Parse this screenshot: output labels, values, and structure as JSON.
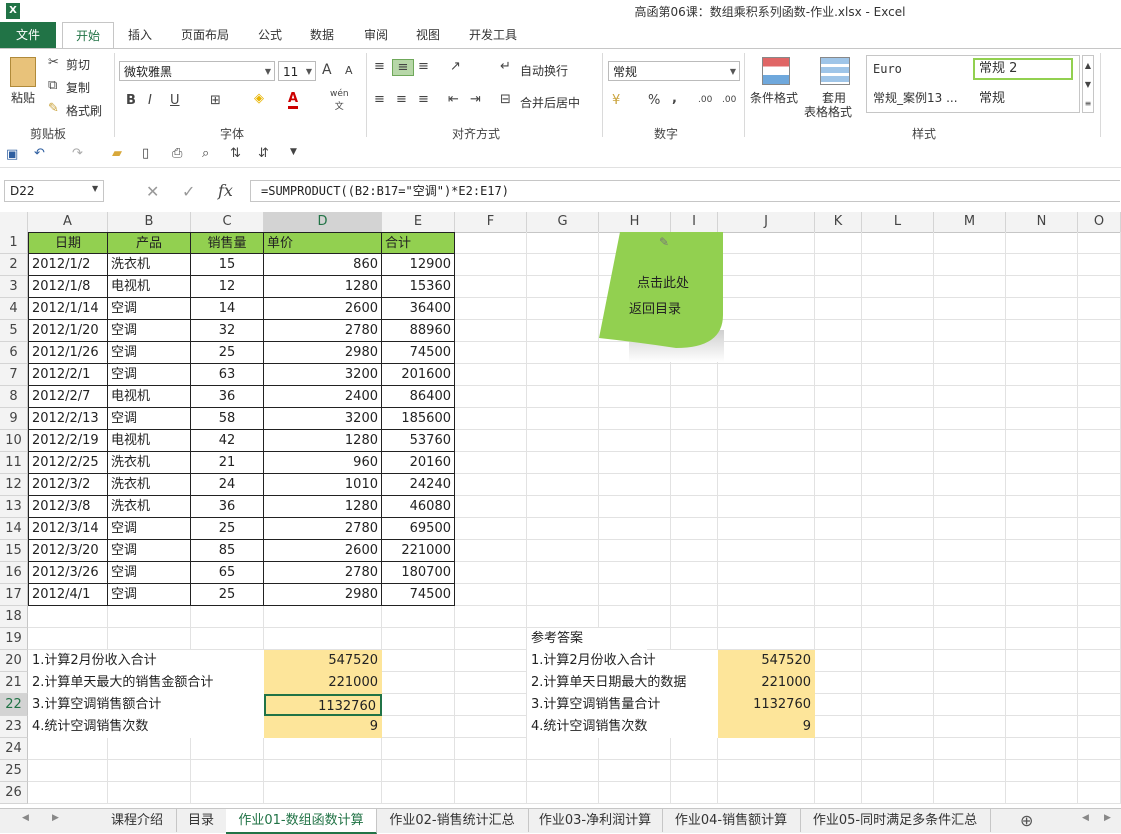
{
  "window": {
    "title": "高函第06课：数组乘积系列函数-作业.xlsx - Excel",
    "logo": "X"
  },
  "ribbon_tabs": [
    "文件",
    "开始",
    "插入",
    "页面布局",
    "公式",
    "数据",
    "审阅",
    "视图",
    "开发工具"
  ],
  "ribbon": {
    "clipboard": {
      "paste": "粘贴",
      "cut": "剪切",
      "copy": "复制",
      "format_painter": "格式刷",
      "group": "剪贴板"
    },
    "font": {
      "name": "微软雅黑",
      "size": "11",
      "group": "字体",
      "bold": "B",
      "italic": "I",
      "underline": "U",
      "grow": "A",
      "shrink": "A",
      "color": "A",
      "phonetic": "wén",
      "phonetic_char": "文"
    },
    "alignment": {
      "wrap": "自动换行",
      "merge": "合并后居中",
      "group": "对齐方式"
    },
    "number": {
      "format": "常规",
      "percent": "%",
      "comma": ",",
      "inc": ".00",
      "dec": ".00",
      "group": "数字"
    },
    "styles": {
      "cond": "条件格式",
      "table1": "套用",
      "table2": "表格格式",
      "s1": "Euro",
      "s2": "常规 2",
      "s3": "常规_案例13 ...",
      "s4": "常规",
      "group": "样式"
    }
  },
  "formula_bar": {
    "name_box": "D22",
    "fx": "fx",
    "cancel": "✕",
    "enter": "✓",
    "formula": "=SUMPRODUCT((B2:B17=\"空调\")*E2:E17)"
  },
  "columns": [
    "A",
    "B",
    "C",
    "D",
    "E",
    "F",
    "G",
    "H",
    "I",
    "J",
    "K",
    "L",
    "M",
    "N",
    "O"
  ],
  "rows": [
    "1",
    "2",
    "3",
    "4",
    "5",
    "6",
    "7",
    "8",
    "9",
    "10",
    "11",
    "12",
    "13",
    "14",
    "15",
    "16",
    "17",
    "18",
    "19",
    "20",
    "21",
    "22",
    "23",
    "24",
    "25",
    "26"
  ],
  "table": {
    "headers": [
      "日期",
      "产品",
      "销售量",
      "单价",
      "合计"
    ],
    "rows": [
      [
        "2012/1/2",
        "洗衣机",
        "15",
        "860",
        "12900"
      ],
      [
        "2012/1/8",
        "电视机",
        "12",
        "1280",
        "15360"
      ],
      [
        "2012/1/14",
        "空调",
        "14",
        "2600",
        "36400"
      ],
      [
        "2012/1/20",
        "空调",
        "32",
        "2780",
        "88960"
      ],
      [
        "2012/1/26",
        "空调",
        "25",
        "2980",
        "74500"
      ],
      [
        "2012/2/1",
        "空调",
        "63",
        "3200",
        "201600"
      ],
      [
        "2012/2/7",
        "电视机",
        "36",
        "2400",
        "86400"
      ],
      [
        "2012/2/13",
        "空调",
        "58",
        "3200",
        "185600"
      ],
      [
        "2012/2/19",
        "电视机",
        "42",
        "1280",
        "53760"
      ],
      [
        "2012/2/25",
        "洗衣机",
        "21",
        "960",
        "20160"
      ],
      [
        "2012/3/2",
        "洗衣机",
        "24",
        "1010",
        "24240"
      ],
      [
        "2012/3/8",
        "洗衣机",
        "36",
        "1280",
        "46080"
      ],
      [
        "2012/3/14",
        "空调",
        "25",
        "2780",
        "69500"
      ],
      [
        "2012/3/20",
        "空调",
        "85",
        "2600",
        "221000"
      ],
      [
        "2012/3/26",
        "空调",
        "65",
        "2780",
        "180700"
      ],
      [
        "2012/4/1",
        "空调",
        "25",
        "2980",
        "74500"
      ]
    ]
  },
  "questions": [
    {
      "label": "1.计算2月份收入合计",
      "value": "547520"
    },
    {
      "label": "2.计算单天最大的销售金额合计",
      "value": "221000"
    },
    {
      "label": "3.计算空调销售额合计",
      "value": "1132760"
    },
    {
      "label": "4.统计空调销售次数",
      "value": "9"
    }
  ],
  "answers": {
    "title": "参考答案",
    "items": [
      {
        "label": "1.计算2月份收入合计",
        "value": "547520"
      },
      {
        "label": "2.计算单天日期最大的数据",
        "value": "221000"
      },
      {
        "label": "3.计算空调销售量合计",
        "value": "1132760"
      },
      {
        "label": "4.统计空调销售次数",
        "value": "9"
      }
    ]
  },
  "sticky_note": {
    "line1": "点击此处",
    "line2": "返回目录",
    "color": "#92d050"
  },
  "sheet_tabs": [
    "课程介绍",
    "目录",
    "作业01-数组函数计算",
    "作业02-销售统计汇总",
    "作业03-净利润计算",
    "作业04-销售额计算",
    "作业05-同时满足多条件汇总"
  ],
  "active_sheet": "作业01-数组函数计算",
  "add_sheet": "⊕"
}
